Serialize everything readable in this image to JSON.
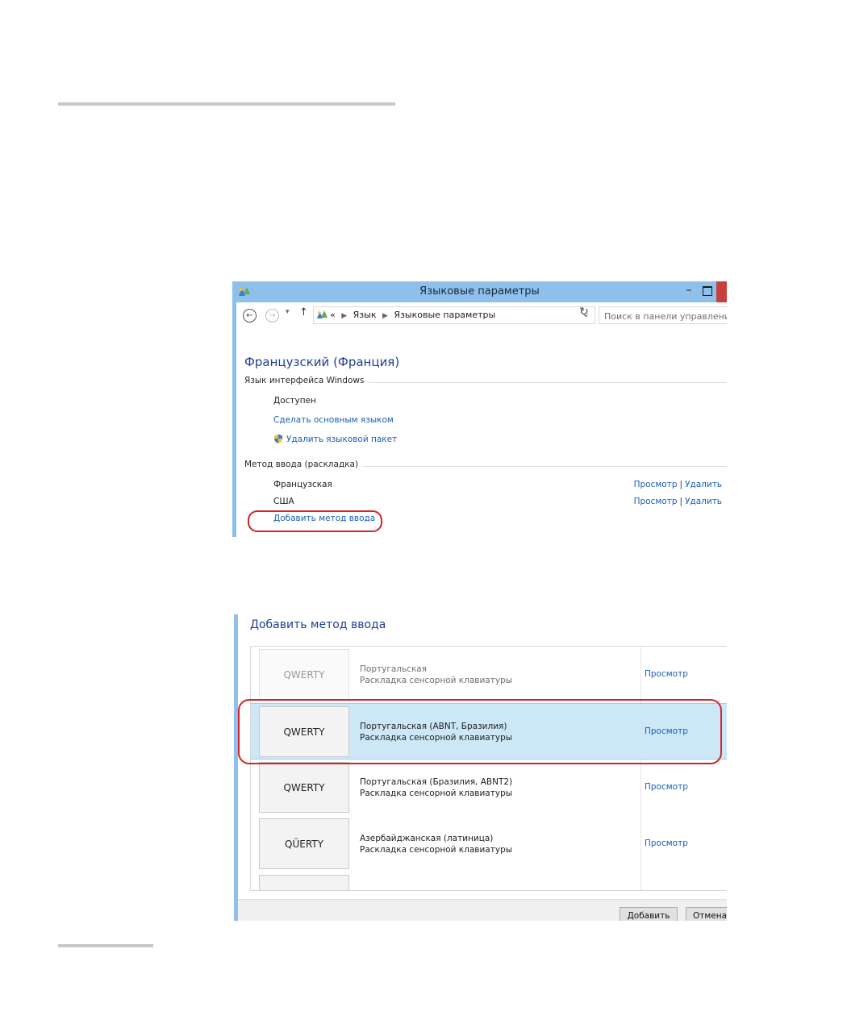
{
  "window1": {
    "title": "Языковые параметры",
    "minimize_glyph": "–",
    "address": {
      "prefix": "«",
      "crumbs": [
        "Язык",
        "Языковые параметры"
      ],
      "search_placeholder": "Поиск в панели управления"
    },
    "language_heading": "Французский (Франция)",
    "interface_section": {
      "label": "Язык интерфейса Windows",
      "status": "Доступен",
      "make_primary_link": "Сделать основным языком",
      "remove_pack_link": "Удалить языковой пакет"
    },
    "input_section": {
      "label": "Метод ввода (раскладка)",
      "methods": [
        {
          "name": "Французская",
          "preview": "Просмотр",
          "remove": "Удалить"
        },
        {
          "name": "США",
          "preview": "Просмотр",
          "remove": "Удалить"
        }
      ],
      "add_link": "Добавить метод ввода"
    }
  },
  "window2": {
    "heading": "Добавить метод ввода",
    "layouts": [
      {
        "thumb": "QWERTY",
        "name": "Португальская",
        "sub": "Раскладка сенсорной клавиатуры",
        "preview": "Просмотр",
        "state": "faded"
      },
      {
        "thumb": "QWERTY",
        "name": "Португальская (ABNT, Бразилия)",
        "sub": "Раскладка сенсорной клавиатуры",
        "preview": "Просмотр",
        "state": "selected"
      },
      {
        "thumb": "QWERTY",
        "name": "Португальская (Бразилия, ABNT2)",
        "sub": "Раскладка сенсорной клавиатуры",
        "preview": "Просмотр",
        "state": "normal"
      },
      {
        "thumb": "QÜERTY",
        "name": "Азербайджанская (латиница)",
        "sub": "Раскладка сенсорной клавиатуры",
        "preview": "Просмотр",
        "state": "normal"
      }
    ],
    "buttons": {
      "add": "Добавить",
      "cancel": "Отмена"
    }
  },
  "colors": {
    "title_bar": "#8fc0ec",
    "link": "#1a5fb4",
    "heading": "#1e3f94",
    "highlight_ring": "#d0232b",
    "selected_row": "#cce8f7"
  }
}
